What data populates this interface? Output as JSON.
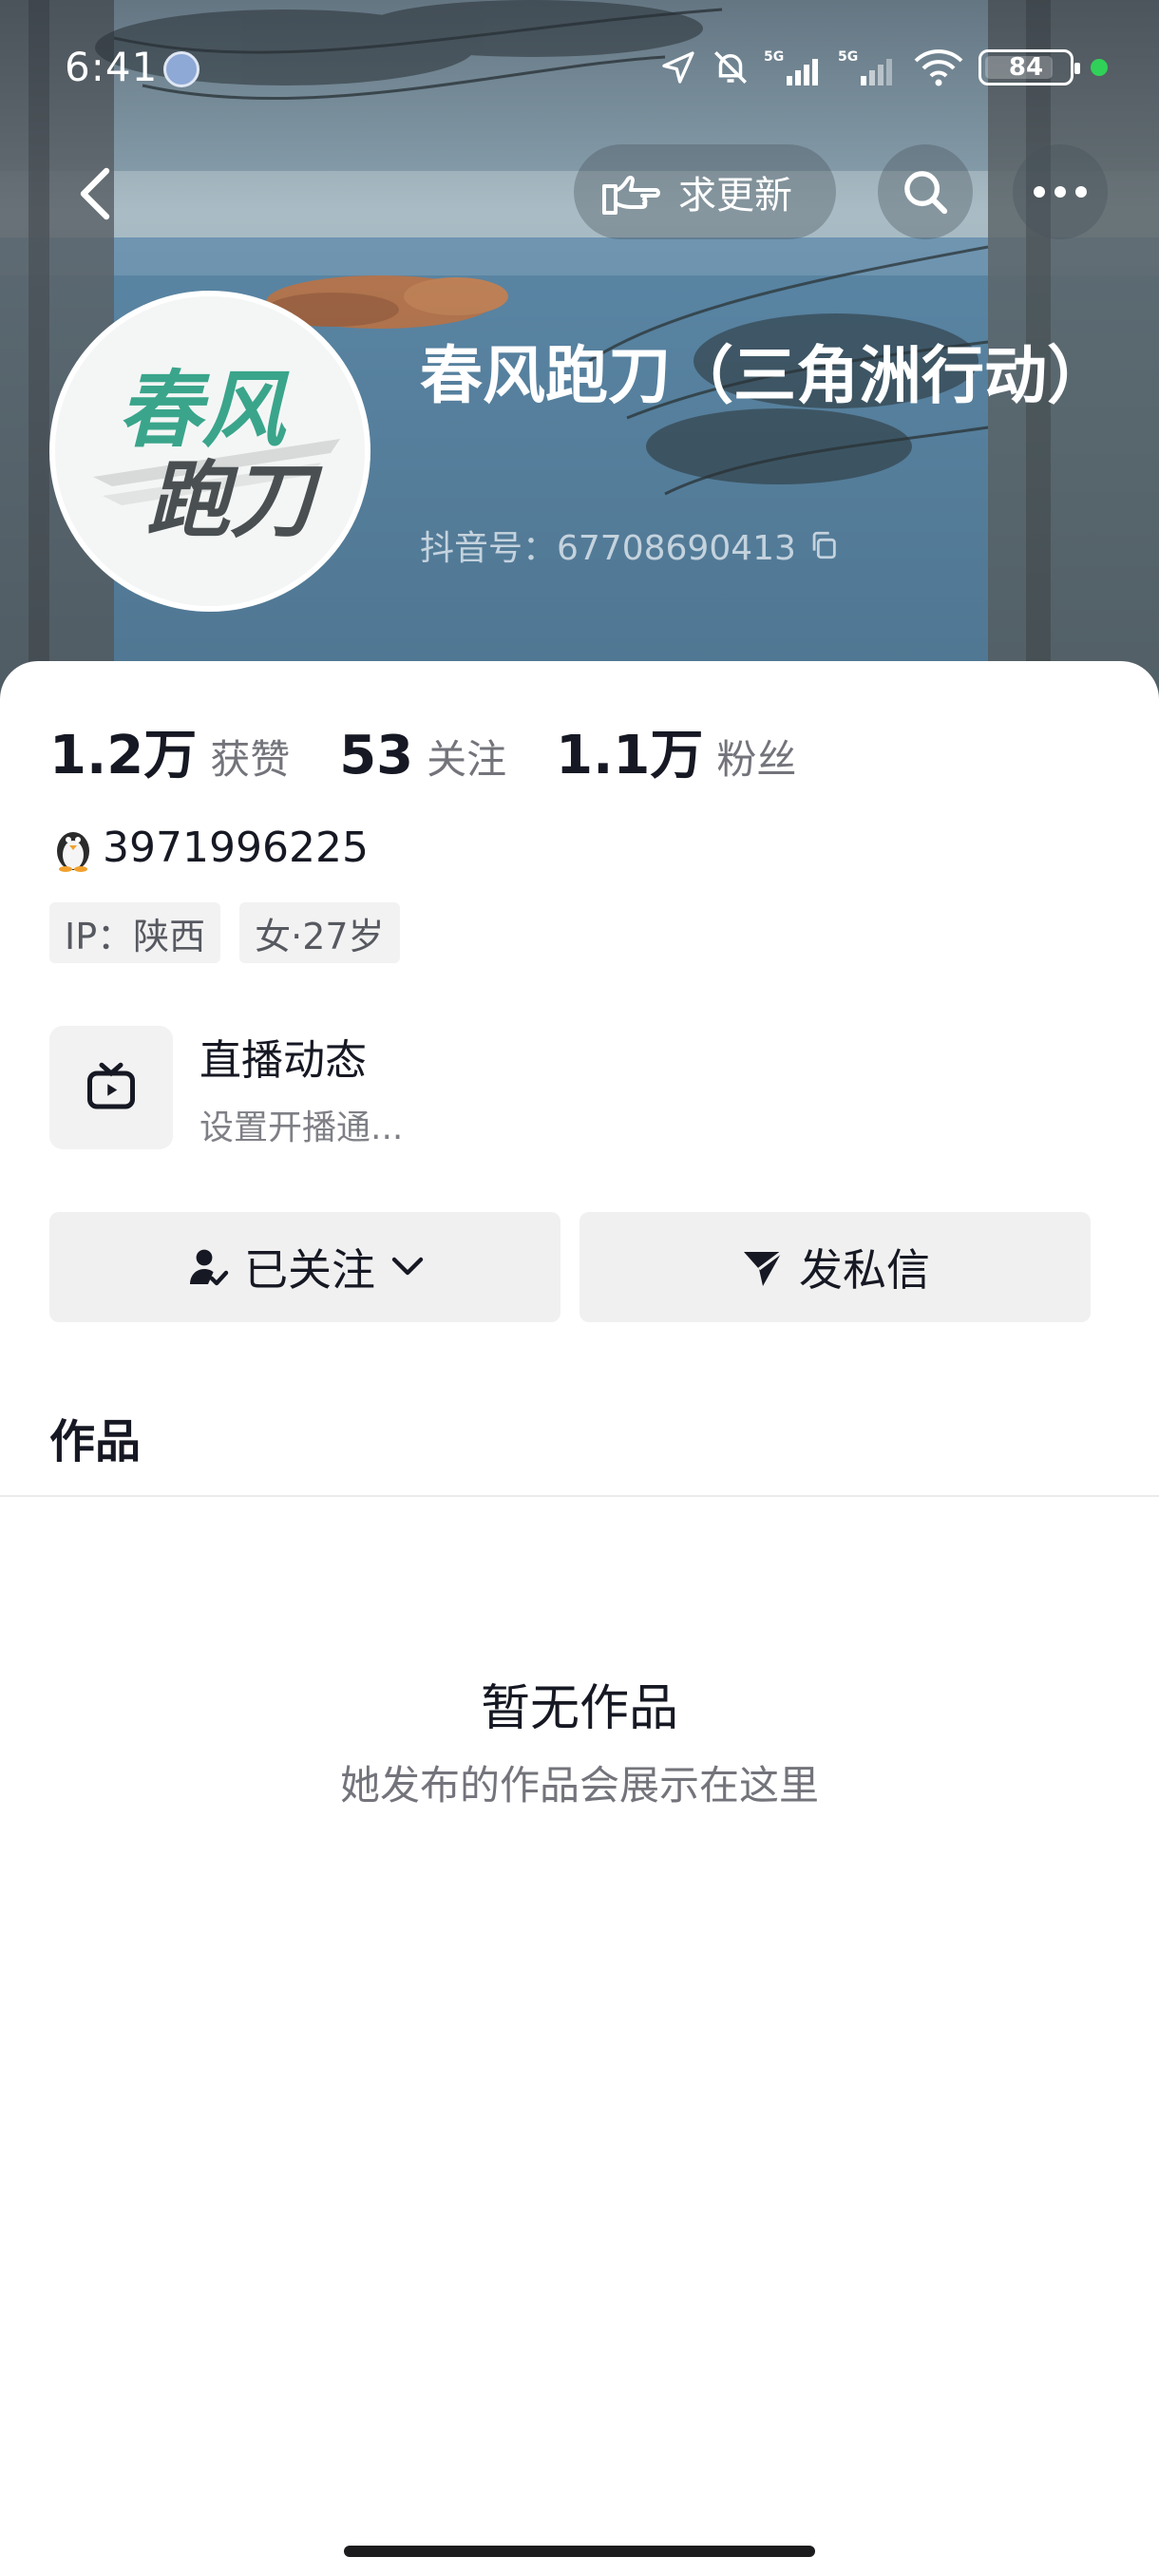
{
  "status_bar": {
    "time": "6:41",
    "battery": "84"
  },
  "nav": {
    "request_update_label": "求更新"
  },
  "profile": {
    "avatar_text_line1": "春风",
    "avatar_text_line2": "跑刀",
    "nickname": "春风跑刀（三角洲行动）",
    "douyin_id": "抖音号：67708690413"
  },
  "stats": [
    {
      "value": "1.2万",
      "label": "获赞"
    },
    {
      "value": "53",
      "label": "关注"
    },
    {
      "value": "1.1万",
      "label": "粉丝"
    }
  ],
  "qq_number": "3971996225",
  "tags": [
    "IP：陕西",
    "女·27岁"
  ],
  "live": {
    "title": "直播动态",
    "subtitle": "设置开播通..."
  },
  "buttons": {
    "follow": "已关注",
    "message": "发私信"
  },
  "tabs": {
    "works": "作品"
  },
  "empty": {
    "title": "暂无作品",
    "subtitle": "她发布的作品会展示在这里"
  }
}
